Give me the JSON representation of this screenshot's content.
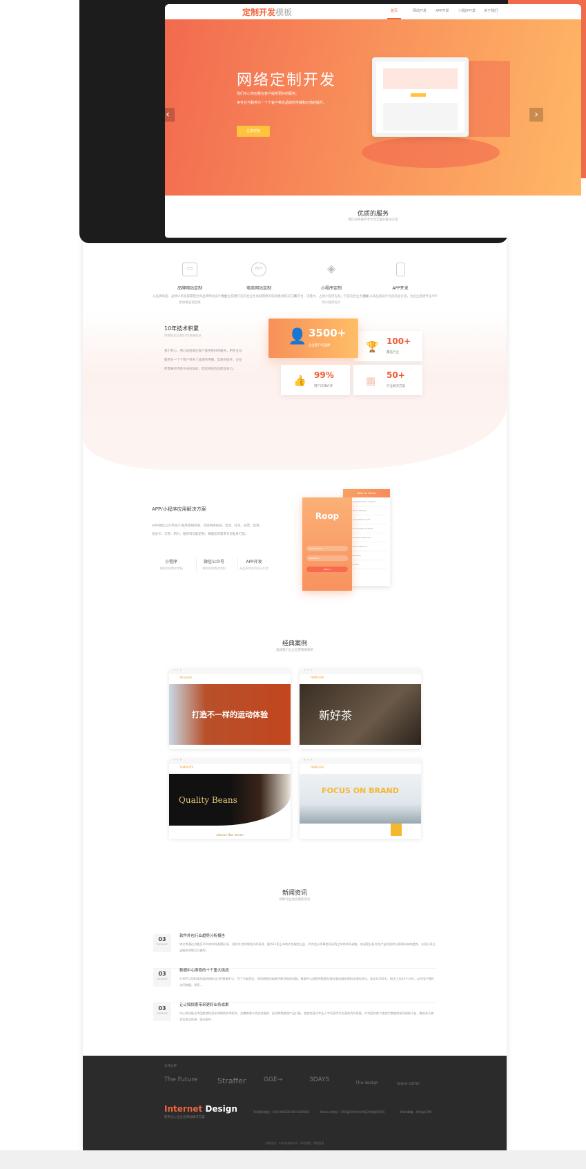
{
  "header": {
    "logo_main": "定制开发",
    "logo_sub": "模板",
    "nav": [
      "首页",
      "网站开发",
      "APP开发",
      "小程序开发",
      "关于我们"
    ],
    "active": 0
  },
  "hero": {
    "title": "网络定制开发",
    "lines": [
      "我们专心地但我在客户提供更好的服务。",
      "用专业与勤劳为一个个客户带去品牌的传播和价值的提升。"
    ],
    "button": "立即定制",
    "prev_icon": "‹",
    "next_icon": "›"
  },
  "services": {
    "title": "优质的服务",
    "subtitle": "我们分析服务专行为全面的解决方案",
    "items": [
      {
        "icon": "devices-icon",
        "glyph": "▭",
        "title": "品牌网站定制",
        "desc": "从品牌高度、品牌VI系统部署整合到品牌网站设计的视觉效果呈现出来"
      },
      {
        "icon": "buy-cursor-icon",
        "glyph": "BUY",
        "title": "电商网站定制",
        "desc": "为企业搭建打造符合业务发展需要的电商模式解决方案"
      },
      {
        "icon": "layers-icon",
        "glyph": "◈",
        "title": "小程序定制",
        "desc": "两平台、流量大、占领小程序先机，打造符合业务发展的小程序设计"
      },
      {
        "icon": "phone-icon",
        "glyph": "▯",
        "title": "APP开发",
        "desc": "我们以高品质设计创造商业价值，为企业搭建专业APP"
      }
    ]
  },
  "tech": {
    "title": "10年技术积累",
    "subtitle": "用数据见证我们的发展成长",
    "lines": [
      "我们专心、用心地但每位客户提供更好的服务。用专业与",
      "勤劳为一个个客户带去了品牌的传播、实质的提升。企业",
      "所需要的不是今天的炫彩，而是持续的品牌竞争力。"
    ],
    "stats": [
      {
        "icon": "user-icon",
        "glyph": "👤",
        "value": "3500+",
        "label": "企业客户的选择"
      },
      {
        "icon": "trophy-icon",
        "glyph": "🏆",
        "value": "100+",
        "label": "覆盖行业"
      },
      {
        "icon": "thumbs-up-icon",
        "glyph": "👍",
        "value": "99%",
        "label": "用户口碑好评"
      },
      {
        "icon": "presentation-icon",
        "glyph": "▦",
        "value": "50+",
        "label": "行业解决方案"
      }
    ]
  },
  "app": {
    "title": "APP/小程序应用解决方案",
    "lines": [
      "APP/微信公众平台/小程序定制开发、可提供微商城、活动、红包、投票、签到、",
      "会员卡、订购、积分、抽奖等功能定制，根据您的需求为您贴身打造。"
    ],
    "cols": [
      {
        "title": "小程序",
        "desc": "按照您的需求定制"
      },
      {
        "title": "微信公众号",
        "desc": "按照您的需求定制"
      },
      {
        "title": "APP开发",
        "desc": "高品质的应用设计打造"
      }
    ],
    "phone_logo": "Roop",
    "phone_fields": [
      "Email Adress",
      "Password"
    ],
    "phone_button": "Sign in",
    "list_header": "Work On Mouse",
    "list_rows": [
      "Sed Quia Aspernatur Adipisci",
      "Fugiat Nulla Pariatur",
      "Ipsam Voluptatem Quia",
      "Magnam Aliquam Quaerat",
      "Nostrum Exercitationem",
      "Quis Autem Vel Eum",
      "Nihil Molestiae",
      "Consequatur"
    ]
  },
  "cases": {
    "title": "经典案例",
    "subtitle": "选择我们让企业营销更简单",
    "items": [
      {
        "brand": "Template",
        "headline": "打造不一样的运动体验",
        "caption": ""
      },
      {
        "brand": "TEMPLATE",
        "headline": "新好茶",
        "caption": ""
      },
      {
        "brand": "TEMPLATE",
        "headline": "Quality Beans",
        "caption": "About the store"
      },
      {
        "brand": "TEMPLATE",
        "headline": "FOCUS ON BRAND",
        "caption": ""
      }
    ]
  },
  "news": {
    "title": "新闻资讯",
    "subtitle": "新鲜行业动态最新资讯",
    "items": [
      {
        "day": "03",
        "ym": "2019-07",
        "title": "软件外包行业趋势分析报告",
        "desc": "本文将通过对截至10年的市场规模分析、国外外包领域龙头的表现、国内12家上市的外包服务企业、四大会计师事务所近两三年的市场调查，来深度分析外包产业的现状与预测未来的趋势，以及分享企业服务领域可以做的…"
      },
      {
        "day": "03",
        "ym": "2019-07",
        "title": "数据中心面临的十个重大挑战",
        "desc": "许多IT公司和其他组织都有自己的数据中心，为了节省资金，同时避免因电源中断导致的问题，数据中心就是所数据存储在服务器处理和存储的地方，其全年365天，每天工作24个小时，以供用户随时访问数据，然而…"
      },
      {
        "day": "03",
        "ym": "2019-07",
        "title": "让认知探索带来更好业务成果",
        "desc": "中心将在推动中国旅游信息化领域的学术研究、支撑旅游公共信息服务、促进传统旅游产业升级、旅游信息化专业人才培养四大方面的共同发展，作为国内首个旅游大数据的协同创新平台，整合多方旅游信息及资源，面向国内…"
      }
    ]
  },
  "footer": {
    "partners_label": "合作伙伴",
    "partners": [
      "The Future",
      "Straffer",
      "GGE→",
      "3DAYS",
      "The design",
      "DESIGN CENTER"
    ],
    "brand_a": "Internet",
    "brand_b": "Design",
    "slogan": "提供全心全企业网站解决方案",
    "tel": "Tel/联系电话：020-000000 000-000000",
    "address": "Address/地址：XXX省XXX市XXX区XXX路XXX号",
    "mail": "Mail/邮箱：XXX@COM",
    "copyright": "技术支持：XX科技有限公司 · 网站地图 · 管理登录"
  },
  "colors": {
    "accent": "#f0643c",
    "hero_start": "#f26a4f",
    "hero_end": "#ffb766",
    "button": "#ffc33d",
    "footer": "#2b2b2b"
  }
}
